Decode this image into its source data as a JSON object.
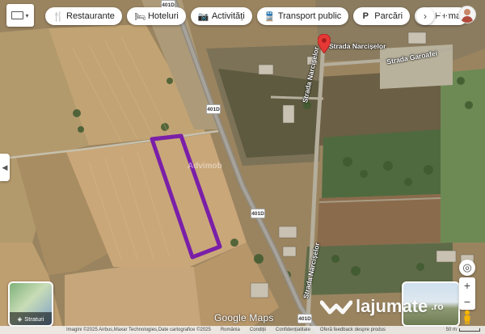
{
  "toolbar": {
    "chips": [
      {
        "label": "Restaurante",
        "icon": "utensils-icon"
      },
      {
        "label": "Hoteluri",
        "icon": "bed-icon"
      },
      {
        "label": "Activități",
        "icon": "camera-icon"
      },
      {
        "label": "Transport public",
        "icon": "train-icon"
      },
      {
        "label": "Parcări",
        "icon": "parking-icon"
      },
      {
        "label": "Farma",
        "icon": "pharmacy-icon"
      }
    ]
  },
  "map": {
    "streets": [
      {
        "label": "Strada Narcișelor"
      },
      {
        "label": "Strada Garoafei"
      },
      {
        "label": "Strada Narcișelor"
      },
      {
        "label": "Strada Narcișelor"
      }
    ],
    "road_shields": [
      "401D",
      "401D",
      "401D",
      "401D"
    ],
    "pin_label": "Strada Narcișelor",
    "colors": {
      "parcel_outline": "#7a1fa8",
      "pin": "#e53935"
    }
  },
  "layers_button": {
    "label": "Straturi"
  },
  "branding": {
    "google_logo": "Google Maps",
    "watermark_name": "lajumate",
    "watermark_tld": ".ro",
    "faint_watermark": "Advimob"
  },
  "footer": {
    "imagery": "Imagini ©2025 Airbus,Maxar Technologies,Date cartografice ©2025",
    "country": "România",
    "terms": "Condiții",
    "privacy": "Confidențialitate",
    "feedback": "Oferă feedback despre produs",
    "scale": "50 m"
  }
}
